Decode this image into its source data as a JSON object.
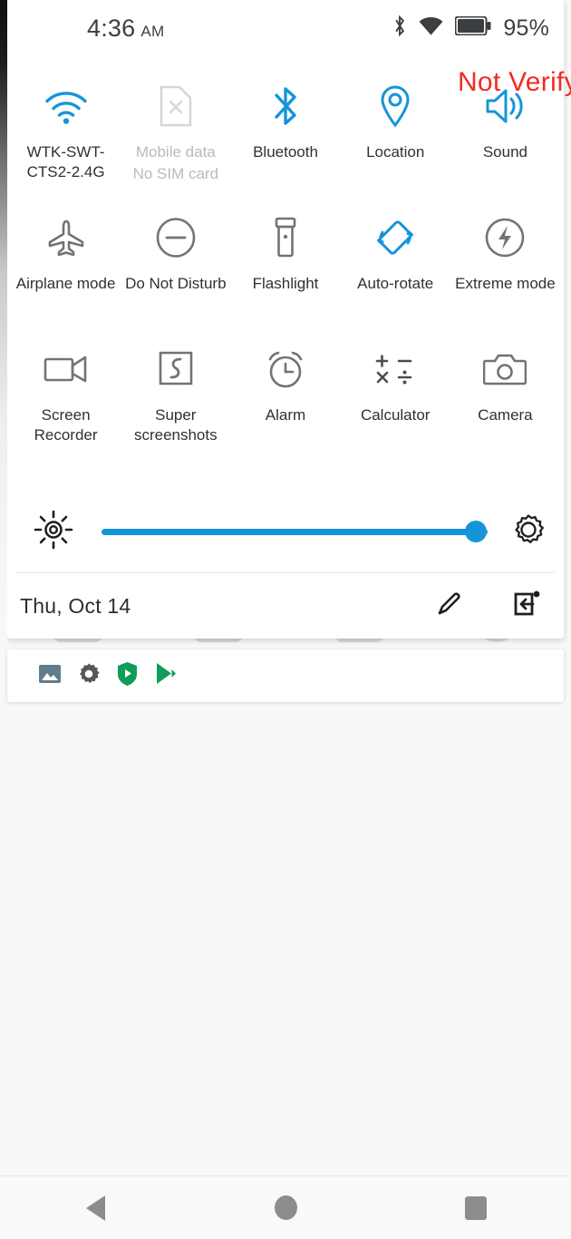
{
  "statusbar": {
    "time": "4:36",
    "ampm": "AM",
    "battery_percent": "95%",
    "icons": [
      "bluetooth-icon",
      "wifi-icon",
      "battery-icon"
    ]
  },
  "watermark": {
    "text": "Not Verify",
    "color": "#f42a22"
  },
  "quick_settings": {
    "accent_color": "#1595d8",
    "disabled_color": "#b6bbbe",
    "rows": [
      {
        "tiles": [
          {
            "name": "wifi",
            "icon": "wifi-icon",
            "label": "WTK-SWT-CTS2-2.4G",
            "state": "active"
          },
          {
            "name": "mobile-data",
            "icon": "sim-card-off-icon",
            "label": "Mobile data",
            "sublabel": "No SIM card",
            "state": "disabled"
          },
          {
            "name": "bluetooth",
            "icon": "bluetooth-icon",
            "label": "Bluetooth",
            "state": "active"
          },
          {
            "name": "location",
            "icon": "location-pin-icon",
            "label": "Location",
            "state": "active"
          },
          {
            "name": "sound",
            "icon": "sound-speaker-icon",
            "label": "Sound",
            "state": "active"
          }
        ]
      },
      {
        "tiles": [
          {
            "name": "airplane-mode",
            "icon": "airplane-icon",
            "label": "Airplane mode",
            "state": "inactive"
          },
          {
            "name": "do-not-disturb",
            "icon": "minus-circle-icon",
            "label": "Do Not Disturb",
            "state": "inactive"
          },
          {
            "name": "flashlight",
            "icon": "flashlight-icon",
            "label": "Flashlight",
            "state": "inactive"
          },
          {
            "name": "auto-rotate",
            "icon": "auto-rotate-icon",
            "label": "Auto-rotate",
            "state": "active"
          },
          {
            "name": "extreme-mode",
            "icon": "lightning-circle-icon",
            "label": "Extreme mode",
            "state": "inactive"
          }
        ]
      },
      {
        "tiles": [
          {
            "name": "screen-recorder",
            "icon": "video-camera-icon",
            "label": "Screen Recorder",
            "state": "inactive"
          },
          {
            "name": "super-screenshots",
            "icon": "scissors-square-icon",
            "label": "Super screenshots",
            "state": "inactive"
          },
          {
            "name": "alarm",
            "icon": "alarm-clock-icon",
            "label": "Alarm",
            "state": "inactive"
          },
          {
            "name": "calculator",
            "icon": "calculator-symbols-icon",
            "label": "Calculator",
            "state": "inactive"
          },
          {
            "name": "camera",
            "icon": "camera-icon",
            "label": "Camera",
            "state": "inactive"
          }
        ]
      }
    ],
    "brightness": {
      "icon": "brightness-sun-icon",
      "value_percent": 97,
      "settings_icon": "gear-icon"
    },
    "footer": {
      "date": "Thu, Oct 14",
      "edit_icon": "pencil-edit-icon",
      "collapse_icon": "collapse-notifications-icon"
    }
  },
  "notifications": {
    "icons": [
      {
        "name": "gallery-icon",
        "color": "#5f7d8c"
      },
      {
        "name": "settings-gear-icon",
        "color": "#575757"
      },
      {
        "name": "play-protect-shield-icon",
        "color": "#0f9d58"
      },
      {
        "name": "play-store-icon",
        "color": "#0f9d58"
      }
    ]
  },
  "navbar": {
    "buttons": [
      {
        "name": "back-button",
        "icon": "back-triangle-icon"
      },
      {
        "name": "home-button",
        "icon": "home-circle-icon"
      },
      {
        "name": "recents-button",
        "icon": "recents-square-icon"
      }
    ]
  }
}
